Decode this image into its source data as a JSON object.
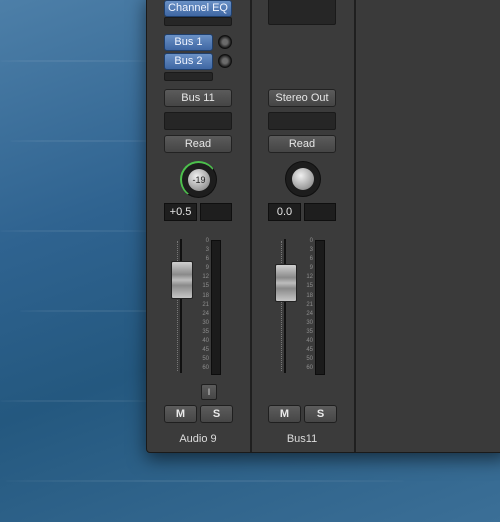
{
  "strip1": {
    "insert_label": "Channel EQ",
    "sends": [
      "Bus 1",
      "Bus 2"
    ],
    "output_label": "Bus 11",
    "automation_label": "Read",
    "pan_value": "-19",
    "volume_value": "+0.5",
    "solo_isolate_label": "I",
    "mute_label": "M",
    "solo_label": "S",
    "track_name": "Audio 9"
  },
  "strip2": {
    "output_label": "Stereo Out",
    "automation_label": "Read",
    "volume_value": "0.0",
    "mute_label": "M",
    "solo_label": "S",
    "track_name": "Bus11"
  },
  "meter_scale": [
    "0",
    "3",
    "6",
    "9",
    "12",
    "15",
    "18",
    "21",
    "24",
    "30",
    "35",
    "40",
    "45",
    "50",
    "60"
  ],
  "colors": {
    "blue_slot": "#4f78b4",
    "strip_bg": "#3b3b3b",
    "pan_ring_green": "#4cc04c"
  }
}
